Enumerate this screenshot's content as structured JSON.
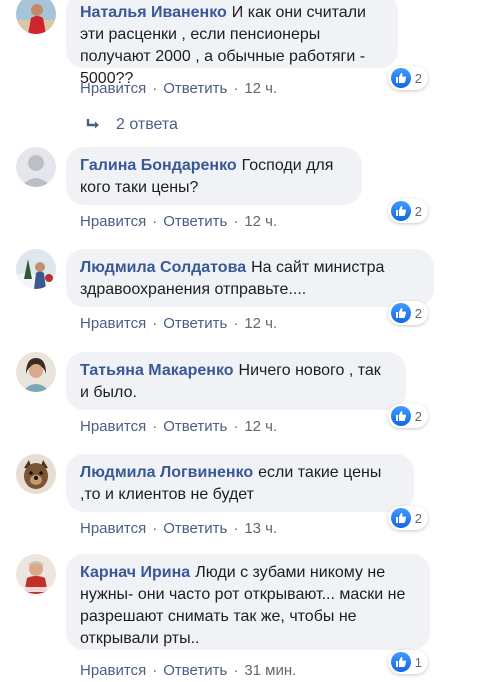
{
  "comments": [
    {
      "author": "Наталья Иваненко",
      "text": "И как они считали эти расценки , если пенсионеры получают 2000 , а обычные работяги - 5000??",
      "like_label": "Нравится",
      "reply_label": "Ответить",
      "time": "12 ч.",
      "reactions": "2",
      "avatar": "woman-red-avatar"
    },
    {
      "author": "Галина Бондаренко",
      "text": "Господи для кого таки цены?",
      "like_label": "Нравится",
      "reply_label": "Ответить",
      "time": "12 ч.",
      "reactions": "2",
      "avatar": "default-avatar"
    },
    {
      "author": "Людмила Солдатова",
      "text": "На сайт министра здравоохранения отправьте....",
      "like_label": "Нравится",
      "reply_label": "Ответить",
      "time": "12 ч.",
      "reactions": "2",
      "avatar": "winter-photo-avatar"
    },
    {
      "author": "Татьяна Макаренко",
      "text": "Ничего нового , так и было.",
      "like_label": "Нравится",
      "reply_label": "Ответить",
      "time": "12 ч.",
      "reactions": "2",
      "avatar": "woman-photo-avatar"
    },
    {
      "author": "Людмила Логвиненко",
      "text": "если такие цены ,то и клиентов не будет",
      "like_label": "Нравится",
      "reply_label": "Ответить",
      "time": "13 ч.",
      "reactions": "2",
      "avatar": "dog-photo-avatar"
    },
    {
      "author": "Карнач Ирина",
      "text": "Люди с зубами никому не нужны- они часто рот открывают... маски не разрешают снимать так же, чтобы не открывали рты..",
      "like_label": "Нравится",
      "reply_label": "Ответить",
      "time": "31 мин.",
      "reactions": "1",
      "avatar": "woman-red-scarf-avatar"
    }
  ],
  "replies": {
    "label": "2 ответа",
    "icon": "reply-arrow-icon"
  },
  "colors": {
    "author": "#385898",
    "bubble": "#f0f2f5",
    "meta": "#65676b",
    "like_blue": "#1877f2"
  }
}
